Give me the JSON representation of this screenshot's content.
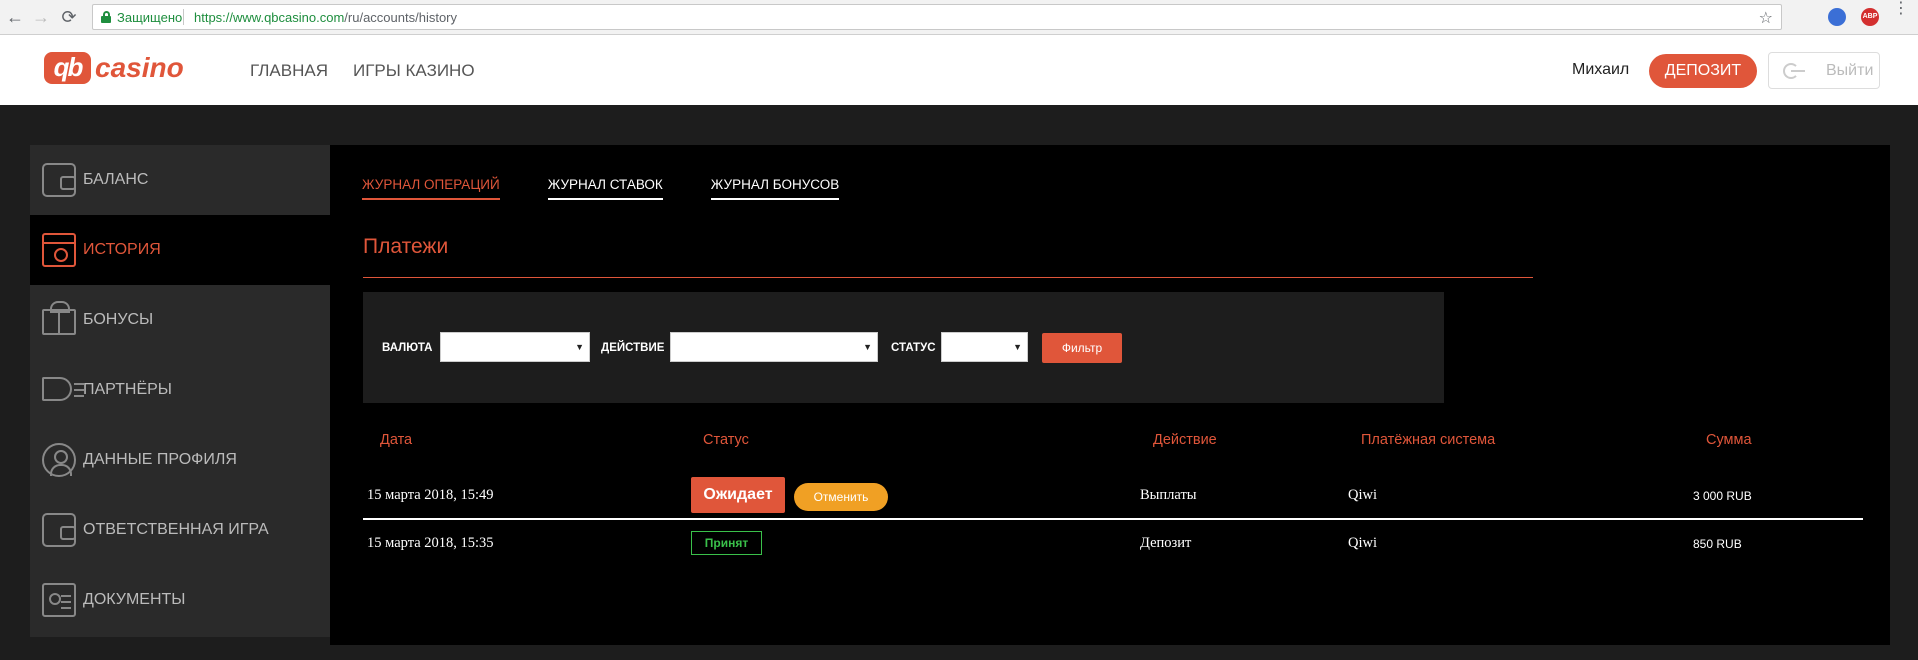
{
  "browser": {
    "back": "←",
    "forward": "→",
    "reload": "⟳",
    "secure_label": "Защищено",
    "url_host": "https://www.qbcasino.com",
    "url_path": "/ru/accounts/history",
    "star": "☆",
    "abp_label": "ABP"
  },
  "header": {
    "logo_mark": "qb",
    "logo_text": "casino",
    "nav": [
      "ГЛАВНАЯ",
      "ИГРЫ КАЗИНО"
    ],
    "user_name": "Михаил",
    "deposit_label": "ДЕПОЗИТ",
    "logout_label": "Выйти",
    "accent_color": "#e0563a"
  },
  "sidebar": {
    "items": [
      {
        "label": "БАЛАНС",
        "icon": "wallet-icon",
        "active": false
      },
      {
        "label": "ИСТОРИЯ",
        "icon": "calendar-clock-icon",
        "active": true
      },
      {
        "label": "БОНУСЫ",
        "icon": "gift-icon",
        "active": false
      },
      {
        "label": "ПАРТНЁРЫ",
        "icon": "megaphone-icon",
        "active": false
      },
      {
        "label": "ДАННЫЕ ПРОФИЛЯ",
        "icon": "user-icon",
        "active": false
      },
      {
        "label": "ОТВЕТСТВЕННАЯ ИГРА",
        "icon": "wallet-icon",
        "active": false
      },
      {
        "label": "ДОКУМЕНТЫ",
        "icon": "id-card-icon",
        "active": false
      }
    ]
  },
  "main": {
    "tabs": [
      {
        "label": "ЖУРНАЛ ОПЕРАЦИЙ",
        "active": true
      },
      {
        "label": "ЖУРНАЛ СТАВОК",
        "active": false
      },
      {
        "label": "ЖУРНАЛ БОНУСОВ",
        "active": false
      }
    ],
    "section_title": "Платежи",
    "filter": {
      "currency_label": "ВАЛЮТА",
      "currency_value": "",
      "action_label": "ДЕЙСТВИЕ",
      "action_value": "",
      "status_label": "СТАТУС",
      "status_value": "",
      "button_label": "Фильтр"
    },
    "table": {
      "columns": [
        "Дата",
        "Статус",
        "Действие",
        "Платёжная система",
        "Сумма"
      ],
      "rows": [
        {
          "date": "15 марта 2018, 15:49",
          "status": "Ожидает",
          "cancel": "Отменить",
          "action": "Выплаты",
          "system": "Qiwi",
          "amount": "3 000 RUB"
        },
        {
          "date": "15 марта 2018, 15:35",
          "status": "Принят",
          "action": "Депозит",
          "system": "Qiwi",
          "amount": "850 RUB"
        }
      ]
    }
  }
}
